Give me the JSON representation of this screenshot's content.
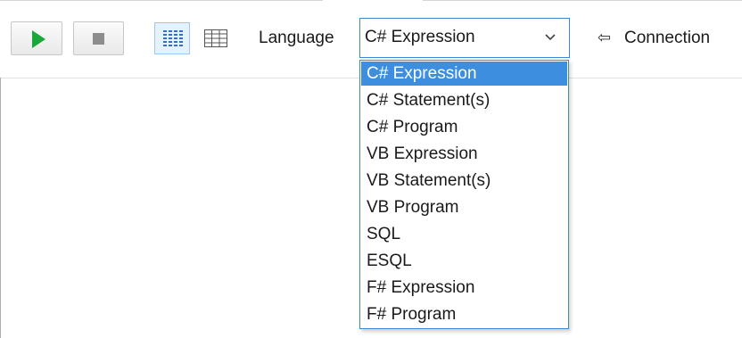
{
  "toolbar": {
    "run_button_icon": "play-icon",
    "stop_button_icon": "stop-icon",
    "rich_view_icon": "rich-text-view-icon",
    "grid_view_icon": "grid-view-icon",
    "language_label": "Language",
    "language_value": "C# Expression",
    "connection_icon": "arrow-left-icon",
    "connection_label": "Connection",
    "run_color": "#19a83a",
    "accent": "#3d8ede"
  },
  "language_dropdown": {
    "selected_index": 0,
    "options": [
      "C# Expression",
      "C# Statement(s)",
      "C# Program",
      "VB Expression",
      "VB Statement(s)",
      "VB Program",
      "SQL",
      "ESQL",
      "F# Expression",
      "F# Program"
    ]
  }
}
